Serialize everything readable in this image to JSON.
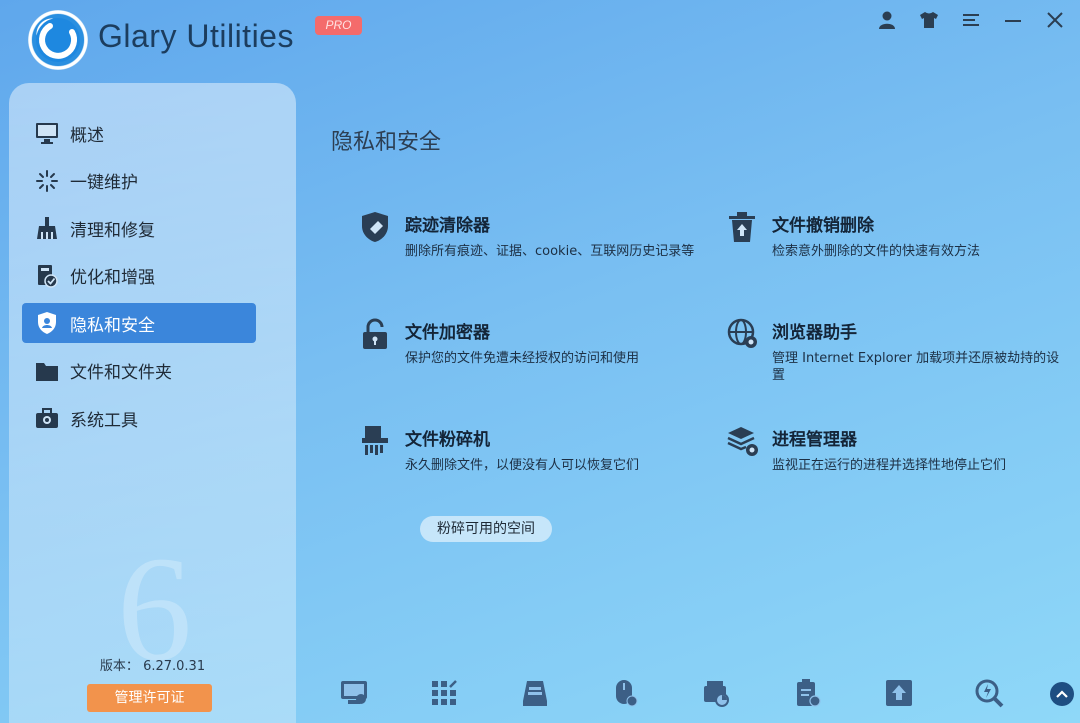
{
  "app": {
    "title": "Glary Utilities",
    "edition_badge": "PRO",
    "brand_color": "#2a8fe0",
    "badge_color": "#f46b6b"
  },
  "window_controls": {
    "icons": [
      "user-icon",
      "skin-shirt-icon",
      "menu-icon",
      "minimize-icon",
      "close-icon"
    ]
  },
  "sidebar": {
    "active_color": "#3b86db",
    "items": [
      {
        "label": "概述",
        "icon": "monitor-icon",
        "active": false
      },
      {
        "label": "一键维护",
        "icon": "sparkle-icon",
        "active": false
      },
      {
        "label": "清理和修复",
        "icon": "broom-icon",
        "active": false
      },
      {
        "label": "优化和增强",
        "icon": "optimize-icon",
        "active": false
      },
      {
        "label": "隐私和安全",
        "icon": "shield-user-icon",
        "active": true
      },
      {
        "label": "文件和文件夹",
        "icon": "folder-icon",
        "active": false
      },
      {
        "label": "系统工具",
        "icon": "toolbox-icon",
        "active": false
      }
    ],
    "version_label": "版本：",
    "version_value": "6.27.0.31",
    "license_button": "管理许可证"
  },
  "main": {
    "title": "隐私和安全",
    "tools": [
      {
        "name": "踪迹清除器",
        "desc": "删除所有痕迹、证据、cookie、互联网历史记录等",
        "icon": "shield-eraser-icon"
      },
      {
        "name": "文件撤销删除",
        "desc": "检索意外删除的文件的快速有效方法",
        "icon": "trash-restore-icon"
      },
      {
        "name": "文件加密器",
        "desc": "保护您的文件免遭未经授权的访问和使用",
        "icon": "lock-icon"
      },
      {
        "name": "浏览器助手",
        "desc": "管理 Internet Explorer 加载项并还原被劫持的设置",
        "icon": "globe-gear-icon"
      },
      {
        "name": "文件粉碎机",
        "desc": "永久删除文件，以便没有人可以恢复它们",
        "icon": "shredder-icon"
      },
      {
        "name": "进程管理器",
        "desc": "监视正在运行的进程并选择性地停止它们",
        "icon": "layers-gear-icon"
      }
    ],
    "shred_free_space": "粉碎可用的空间"
  },
  "bottom_toolbar": {
    "icons": [
      "disk-cleaner-icon",
      "registry-cleaner-icon",
      "disk-repair-icon",
      "mouse-cleanup-icon",
      "disk-analysis-icon",
      "clipboard-gear-icon",
      "software-update-icon",
      "search-tools-icon",
      "scroll-up-icon"
    ]
  }
}
